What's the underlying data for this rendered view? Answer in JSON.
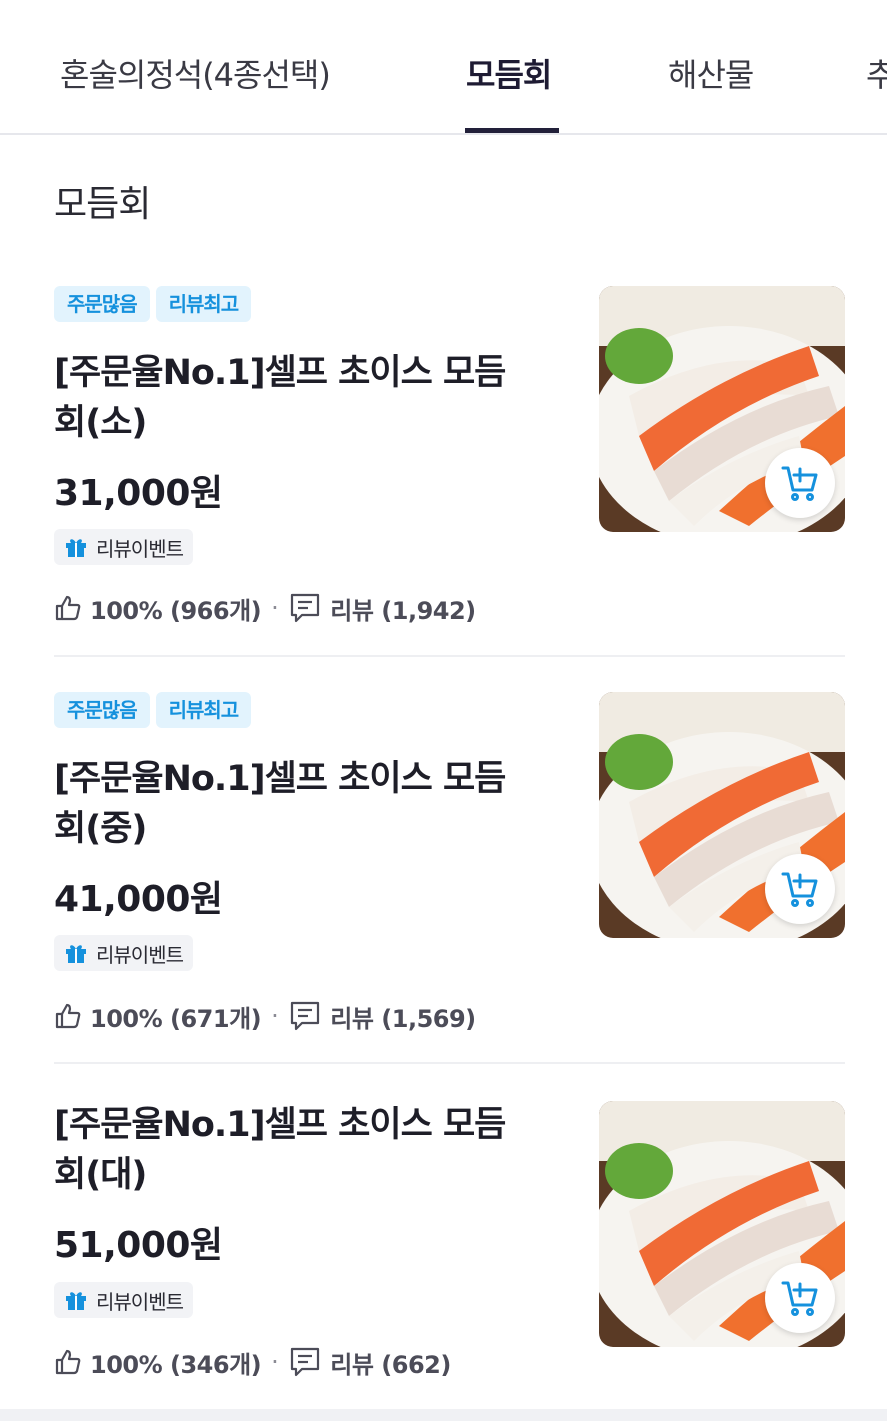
{
  "tabs": [
    {
      "label": "혼술의정석(4종선택)",
      "active": false
    },
    {
      "label": "모듬회",
      "active": true
    },
    {
      "label": "해산물",
      "active": false
    },
    {
      "label": "추",
      "active": false
    }
  ],
  "section": {
    "title": "모듬회"
  },
  "products": [
    {
      "badges": [
        "주문많음",
        "리뷰최고"
      ],
      "name_line1": "[주문율No.1]셀프 초이스 모듬",
      "name_line2": "회(소)",
      "price": "31,000원",
      "event": "리뷰이벤트",
      "like_rate": "100% (966개)",
      "reviews": "리뷰 (1,942)",
      "thumbnail_alt": "모듬회 사진",
      "cart_icon": "cart-add-icon"
    },
    {
      "badges": [
        "주문많음",
        "리뷰최고"
      ],
      "name_line1": "[주문율No.1]셀프 초이스 모듬",
      "name_line2": "회(중)",
      "price": "41,000원",
      "event": "리뷰이벤트",
      "like_rate": "100% (671개)",
      "reviews": "리뷰 (1,569)",
      "thumbnail_alt": "모듬회 사진",
      "cart_icon": "cart-add-icon"
    },
    {
      "badges": [],
      "name_line1": "[주문율No.1]셀프 초이스 모듬",
      "name_line2": "회(대)",
      "price": "51,000원",
      "event": "리뷰이벤트",
      "like_rate": "100% (346개)",
      "reviews": "리뷰 (662)",
      "thumbnail_alt": "모듬회 사진",
      "cart_icon": "cart-add-icon"
    }
  ],
  "separator": "·",
  "colors": {
    "badge_bg": "#e2f3fd",
    "badge_text": "#1591dd",
    "accent": "#1591dd",
    "tab_indicator": "#22203a"
  }
}
